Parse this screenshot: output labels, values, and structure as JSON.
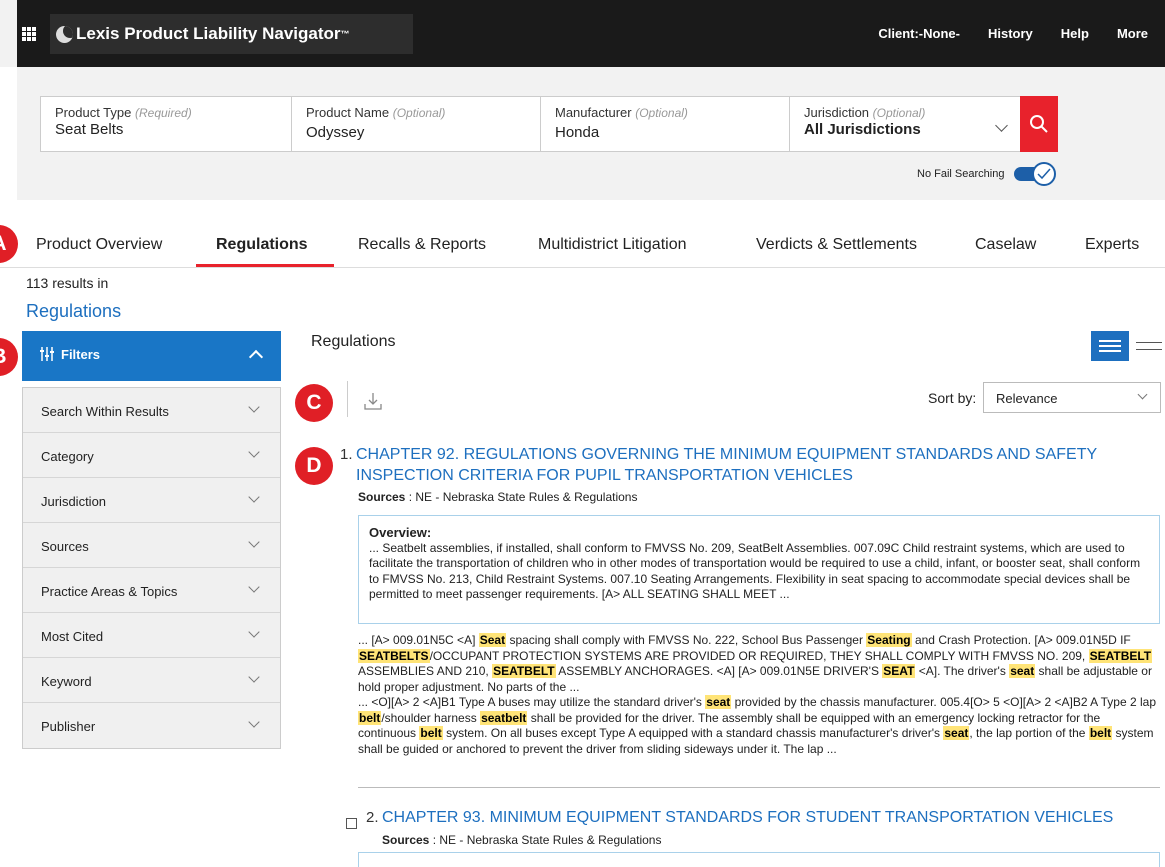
{
  "header": {
    "brand": "Lexis Product Liability Navigator",
    "brand_mark": "™",
    "nav": [
      "Client:-None-",
      "History",
      "Help",
      "More"
    ]
  },
  "search": {
    "fields": [
      {
        "label": "Product Type",
        "qualifier": "(Required)",
        "value": "Seat Belts"
      },
      {
        "label": "Product Name",
        "qualifier": "(Optional)",
        "value": "Odyssey"
      },
      {
        "label": "Manufacturer",
        "qualifier": "(Optional)",
        "value": "Honda"
      },
      {
        "label": "Jurisdiction",
        "qualifier": "(Optional)",
        "value": "All Jurisdictions"
      }
    ],
    "no_fail_label": "No Fail Searching",
    "no_fail_on": true
  },
  "tabs": [
    "Product Overview",
    "Regulations",
    "Recalls & Reports",
    "Multidistrict Litigation",
    "Verdicts & Settlements",
    "Caselaw",
    "Experts"
  ],
  "active_tab": "Regulations",
  "callouts": [
    "A",
    "B",
    "C",
    "D"
  ],
  "results": {
    "count_text": "113 results in",
    "category": "Regulations",
    "section_title": "Regulations",
    "sort_label": "Sort by:",
    "sort_value": "Relevance"
  },
  "filters": {
    "title": "Filters",
    "items": [
      "Search Within Results",
      "Category",
      "Jurisdiction",
      "Sources",
      "Practice Areas & Topics",
      "Most Cited",
      "Keyword",
      "Publisher"
    ]
  },
  "items": [
    {
      "num": "1.",
      "title_line1": "CHAPTER 92. REGULATIONS GOVERNING THE MINIMUM EQUIPMENT STANDARDS AND SAFETY",
      "title_line2": "INSPECTION CRITERIA FOR PUPIL TRANSPORTATION VEHICLES",
      "sources_label": "Sources",
      "sources_value": ": NE - Nebraska State Rules & Regulations",
      "overview_label": "Overview:",
      "overview_text": "... Seatbelt assemblies, if installed, shall conform to FMVSS No. 209, SeatBelt Assemblies. 007.09C Child restraint systems, which are used to facilitate the transportation of children who in other modes of transportation would be required to use a child, infant, or booster seat, shall conform to FMVSS No. 213, Child Restraint Systems. 007.10 Seating Arrangements. Flexibility in seat spacing to accommodate special devices shall be permitted to meet passenger requirements. [A> ALL SEATING SHALL MEET ..."
    },
    {
      "num": "2.",
      "title_line1": "CHAPTER 93. MINIMUM EQUIPMENT STANDARDS FOR STUDENT TRANSPORTATION VEHICLES",
      "sources_label": "Sources",
      "sources_value": ": NE - Nebraska State Rules & Regulations"
    }
  ],
  "snippet_segments": [
    {
      "t": "... [A> 009.01N5C <A] "
    },
    {
      "t": "Seat",
      "h": true
    },
    {
      "t": " spacing shall comply with FMVSS No. 222, School Bus Passenger "
    },
    {
      "t": "Seating",
      "h": true
    },
    {
      "t": " and Crash Protection. [A> 009.01N5D IF "
    },
    {
      "t": "SEATBELTS",
      "h": true
    },
    {
      "t": "/OCCUPANT PROTECTION SYSTEMS ARE PROVIDED OR REQUIRED, THEY SHALL COMPLY WITH FMVSS NO. 209, "
    },
    {
      "t": "SEATBELT",
      "h": true
    },
    {
      "t": " ASSEMBLIES AND 210, "
    },
    {
      "t": "SEATBELT",
      "h": true
    },
    {
      "t": " ASSEMBLY ANCHORAGES. <A] [A> 009.01N5E DRIVER'S "
    },
    {
      "t": "SEAT",
      "h": true
    },
    {
      "t": " <A]. The driver's "
    },
    {
      "t": "seat",
      "h": true
    },
    {
      "t": " shall be adjustable or hold proper adjustment. No parts of the ..."
    },
    {
      "br": true
    },
    {
      "t": "... <O][A> 2 <A]B1 Type A buses may utilize the standard driver's "
    },
    {
      "t": "seat",
      "h": true
    },
    {
      "t": " provided by the chassis manufacturer. 005.4[O> 5 <O][A> 2 <A]B2 A Type 2 lap "
    },
    {
      "t": "belt",
      "h": true
    },
    {
      "t": "/shoulder harness "
    },
    {
      "t": "seatbelt",
      "h": true
    },
    {
      "t": " shall be provided for the driver. The assembly shall be equipped with an emergency locking retractor for the continuous "
    },
    {
      "t": "belt",
      "h": true
    },
    {
      "t": " system. On all buses except Type A equipped with a standard chassis manufacturer's driver's "
    },
    {
      "t": "seat",
      "h": true
    },
    {
      "t": ", the lap portion of the "
    },
    {
      "t": "belt",
      "h": true
    },
    {
      "t": " system shall be guided or anchored to prevent the driver from sliding sideways under it. The lap ..."
    }
  ],
  "colors": {
    "accent_red": "#e8222c",
    "link_blue": "#1d6fbf",
    "filter_blue": "#1976c6",
    "highlight": "#ffe477"
  },
  "icons": [
    "apps-grid-icon",
    "lexis-logo-icon",
    "search-icon",
    "chevron-down-icon",
    "toggle-check-icon",
    "filter-sliders-icon",
    "chevron-up-icon",
    "list-view-icon",
    "compact-view-icon",
    "download-icon"
  ]
}
